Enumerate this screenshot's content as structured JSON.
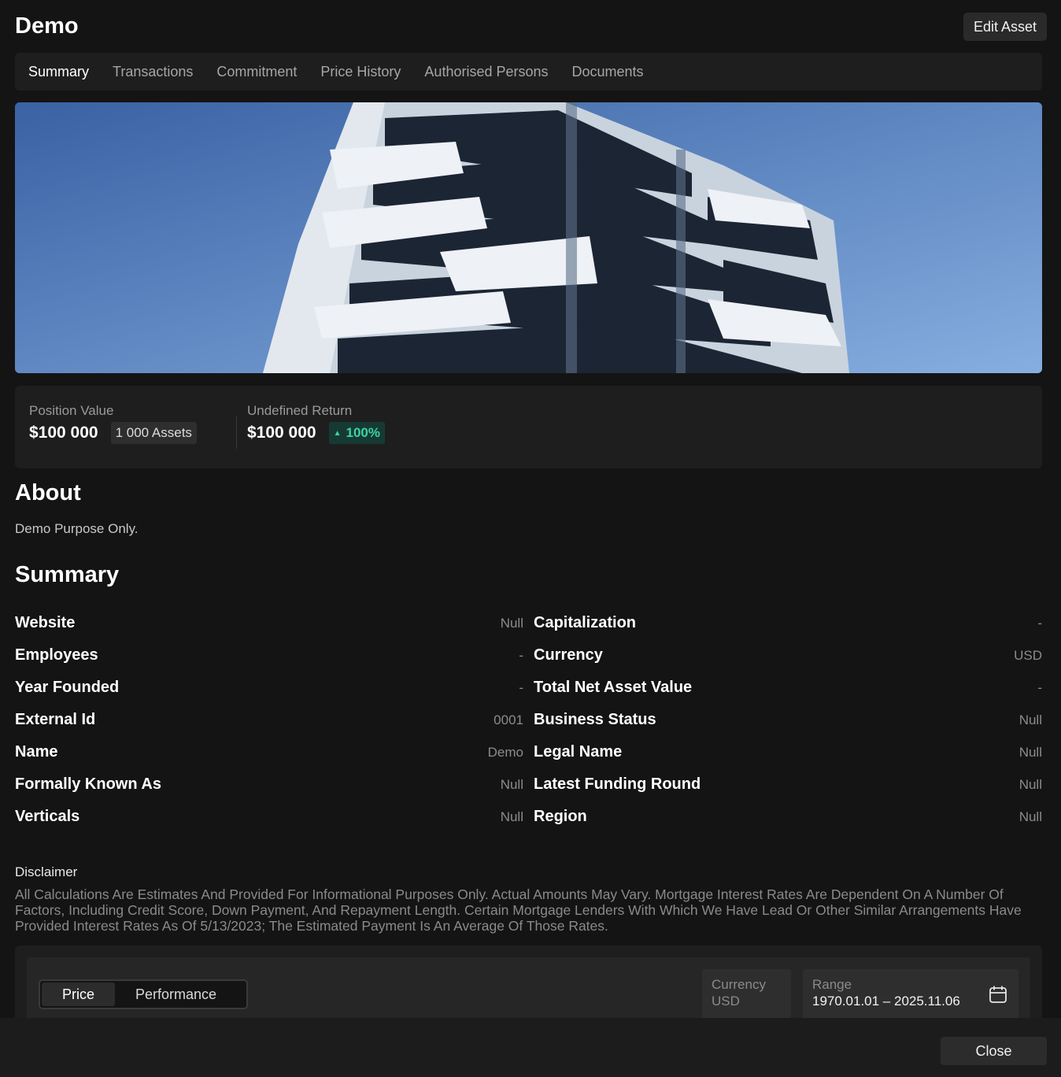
{
  "header": {
    "title": "Demo",
    "edit_label": "Edit Asset"
  },
  "tabs": [
    {
      "label": "Summary"
    },
    {
      "label": "Transactions"
    },
    {
      "label": "Commitment"
    },
    {
      "label": "Price History"
    },
    {
      "label": "Authorised Persons"
    },
    {
      "label": "Documents"
    }
  ],
  "stats": {
    "position": {
      "label": "Position Value",
      "value": "$100 000",
      "badge": "1 000 Assets"
    },
    "return": {
      "label": "Undefined Return",
      "value": "$100 000",
      "badge": "100%"
    }
  },
  "about": {
    "heading": "About",
    "text": "Demo Purpose Only."
  },
  "summary": {
    "heading": "Summary",
    "left": [
      {
        "key": "Website",
        "value": "Null"
      },
      {
        "key": "Employees",
        "value": "-"
      },
      {
        "key": "Year Founded",
        "value": "-"
      },
      {
        "key": "External Id",
        "value": "0001"
      },
      {
        "key": "Name",
        "value": "Demo"
      },
      {
        "key": "Formally Known As",
        "value": "Null"
      },
      {
        "key": "Verticals",
        "value": "Null"
      }
    ],
    "right": [
      {
        "key": "Capitalization",
        "value": "-"
      },
      {
        "key": "Currency",
        "value": "USD"
      },
      {
        "key": "Total Net Asset Value",
        "value": "-"
      },
      {
        "key": "Business Status",
        "value": "Null"
      },
      {
        "key": "Legal Name",
        "value": "Null"
      },
      {
        "key": "Latest Funding Round",
        "value": "Null"
      },
      {
        "key": "Region",
        "value": "Null"
      }
    ]
  },
  "disclaimer": {
    "title": "Disclaimer",
    "text": "All Calculations Are Estimates And Provided For Informational Purposes Only. Actual Amounts May Vary. Mortgage Interest Rates Are Dependent On A Number Of Factors, Including Credit Score, Down Payment, And Repayment Length. Certain Mortgage Lenders With Which We Have Lead Or Other Similar Arrangements Have Provided Interest Rates As Of 5/13/2023; The Estimated Payment Is An Average Of Those Rates."
  },
  "chart_controls": {
    "toggle": [
      "Price",
      "Performance"
    ],
    "currency": {
      "label": "Currency",
      "value": "USD"
    },
    "range": {
      "label": "Range",
      "value": "1970.01.01 – 2025.11.06"
    }
  },
  "footer": {
    "close_label": "Close"
  },
  "colors": {
    "accent_green": "#3fd1a4",
    "background": "#141414",
    "surface": "#1e1e1f"
  }
}
